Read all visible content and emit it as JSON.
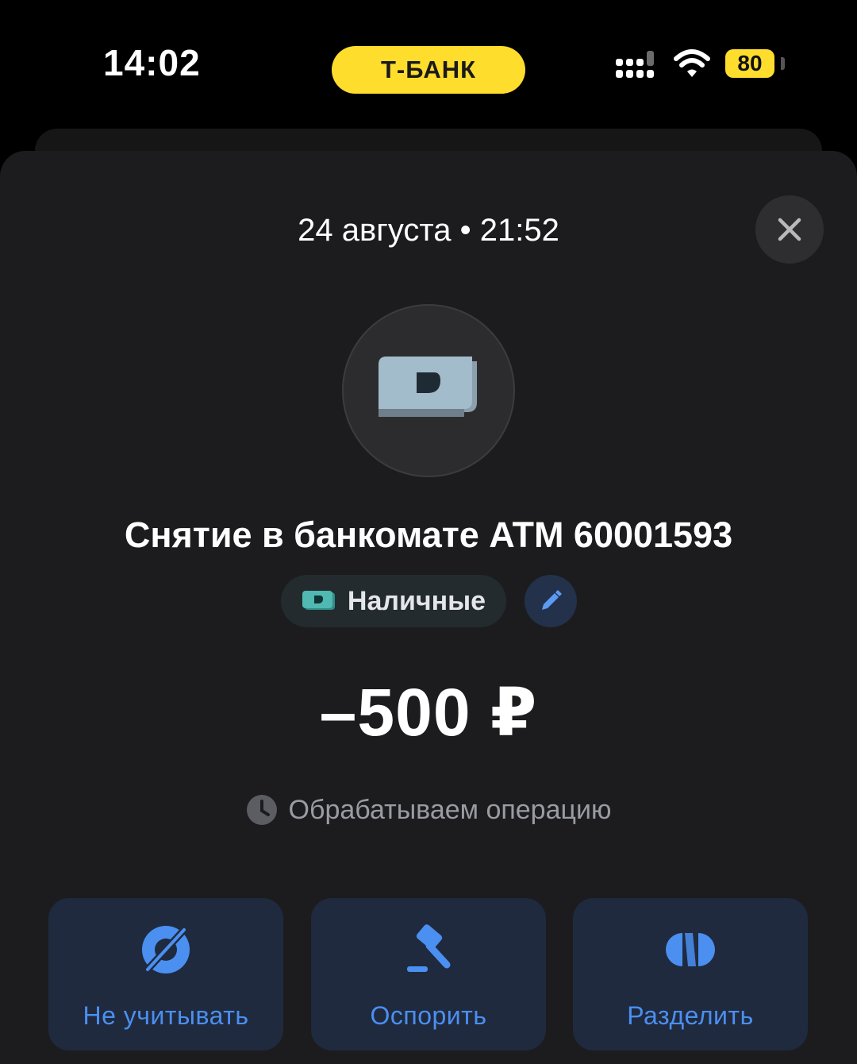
{
  "status_bar": {
    "time": "14:02",
    "bank_name": "Т-БАНК",
    "battery": "80"
  },
  "operation": {
    "datetime": "24 августа • 21:52",
    "title": "Снятие в банкомате ATM 60001593",
    "category": "Наличные",
    "amount": "–500 ₽",
    "status": "Обрабатываем операцию"
  },
  "actions": [
    {
      "label": "Не учитывать",
      "icon": "eye-off-icon"
    },
    {
      "label": "Оспорить",
      "icon": "gavel-icon"
    },
    {
      "label": "Разделить",
      "icon": "split-icon"
    }
  ],
  "colors": {
    "accent_yellow": "#ffdd2d",
    "action_blue": "#4b8ff0",
    "sheet_bg": "#1c1c1e"
  }
}
